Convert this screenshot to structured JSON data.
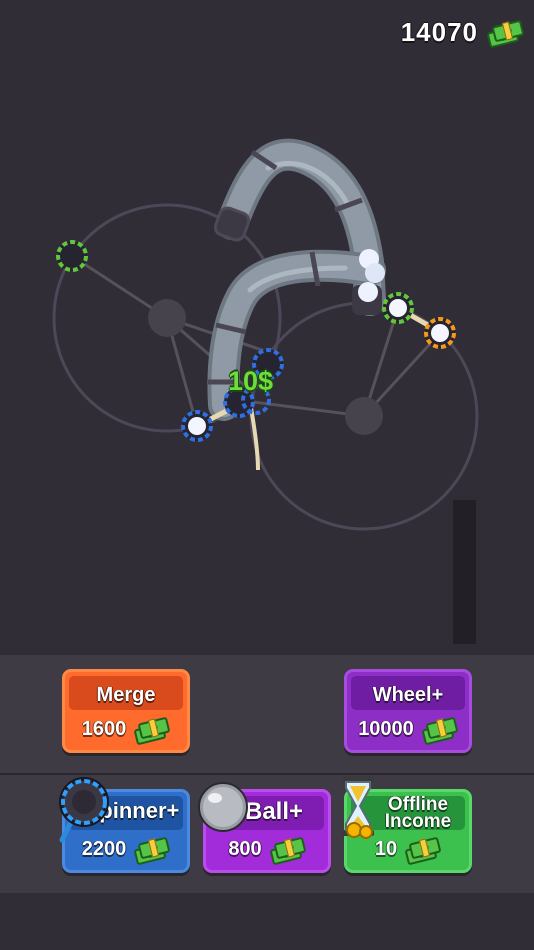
{
  "hud": {
    "money": "14070",
    "money_icon": "cash-stack-icon"
  },
  "game": {
    "floating_reward": "10$",
    "colors": {
      "background": "#302d36",
      "track_ring": "#4e4a5a",
      "pipe": "#8f9aa6",
      "green_ring": "#63c73b",
      "blue_ring": "#2f6fe0",
      "orange_ring": "#f39a1c"
    }
  },
  "shop": {
    "merge": {
      "label": "Merge",
      "price": "1600",
      "color": "#f0592a"
    },
    "wheel": {
      "label": "Wheel+",
      "price": "10000",
      "color": "#8e2ec9"
    },
    "spinner": {
      "label": "Spinner+",
      "price": "2200",
      "color": "#2f6ec9",
      "icon": "magnifier-spinner-icon"
    },
    "ball": {
      "label": "Ball+",
      "price": "800",
      "color": "#9c27d6",
      "icon": "ball-icon"
    },
    "offline": {
      "label_line1": "Offline",
      "label_line2": "Income",
      "price": "10",
      "color": "#35b24a",
      "icon": "hourglass-coins-icon"
    }
  }
}
